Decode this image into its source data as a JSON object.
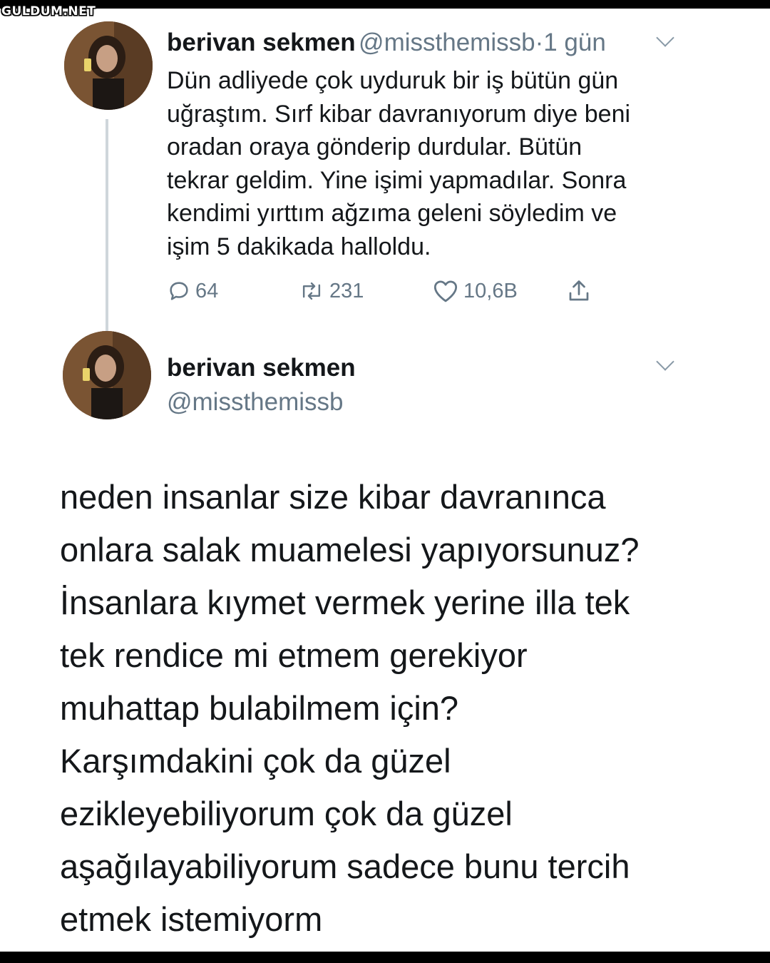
{
  "watermark": "GULDUM.NET",
  "tweet1": {
    "name": "berivan sekmen",
    "handle": "@missthemissb",
    "separator": "·",
    "time": "1 gün",
    "text": "Dün adliyede çok uyduruk bir iş bütün gün\nuğraştım. Sırf kibar davranıyorum diye beni\noradan oraya gönderip durdular. Bütün\ntekrar geldim. Yine işimi yapmadılar. Sonra\nkendimi yırttım ağzıma geleni söyledim ve\nişim  5 dakikada halloldu.",
    "replies": "64",
    "retweets": "231",
    "likes": "10,6B",
    "icons": [
      "reply-icon",
      "retweet-icon",
      "like-icon",
      "share-icon",
      "chevron-down-icon"
    ]
  },
  "tweet2": {
    "name": "berivan sekmen",
    "handle": "@missthemissb",
    "text": "neden insanlar size kibar davranınca\nonlara salak muamelesi yapıyorsunuz?\nİnsanlara kıymet vermek yerine illa tek\ntek rendice mi etmem gerekiyor\nmuhattap bulabilmem için?\nKarşımdakini çok da güzel\nezikleyebiliyorum çok da güzel\naşağılayabiliyorum sadece bunu tercih\netmek istemiyorm"
  },
  "colors": {
    "text": "#14171a",
    "secondary": "#657786",
    "thread_line": "#cfd6db",
    "background": "#ffffff",
    "border": "#000000"
  }
}
